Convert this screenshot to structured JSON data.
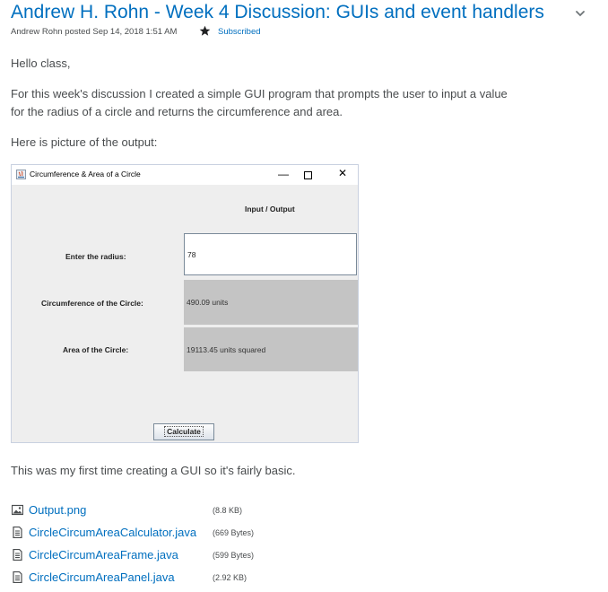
{
  "post": {
    "title": "Andrew H. Rohn - Week 4 Discussion: GUIs and event handlers",
    "meta": "Andrew Rohn posted Sep 14, 2018 1:51 AM",
    "subscribed": "Subscribed",
    "paragraphs": [
      "Hello class,",
      "For this week's discussion I created a simple GUI program that prompts the user to input a value for the radius of a circle and returns the circumference and area.",
      "Here is picture of the output:",
      "This was my first time creating a GUI so it's fairly basic."
    ]
  },
  "java_window": {
    "title": "Circumference & Area of a Circle",
    "min": "—",
    "close": "✕",
    "io_label": "Input / Output",
    "radius_label": "Enter the radius:",
    "radius_value": "78",
    "circ_label": "Circumference of the Circle:",
    "circ_value": "490.09 units",
    "area_label": "Area of the Circle:",
    "area_value": "19113.45 units squared",
    "button": "Calculate"
  },
  "attachments": [
    {
      "name": "Output.png",
      "size": "(8.8 KB)",
      "icon": "image-icon"
    },
    {
      "name": "CircleCircumAreaCalculator.java",
      "size": "(669 Bytes)",
      "icon": "document-icon"
    },
    {
      "name": "CircleCircumAreaFrame.java",
      "size": "(599 Bytes)",
      "icon": "document-icon"
    },
    {
      "name": "CircleCircumAreaPanel.java",
      "size": "(2.92 KB)",
      "icon": "document-icon"
    }
  ],
  "colors": {
    "link": "#006fbf",
    "text": "#494c4e"
  }
}
